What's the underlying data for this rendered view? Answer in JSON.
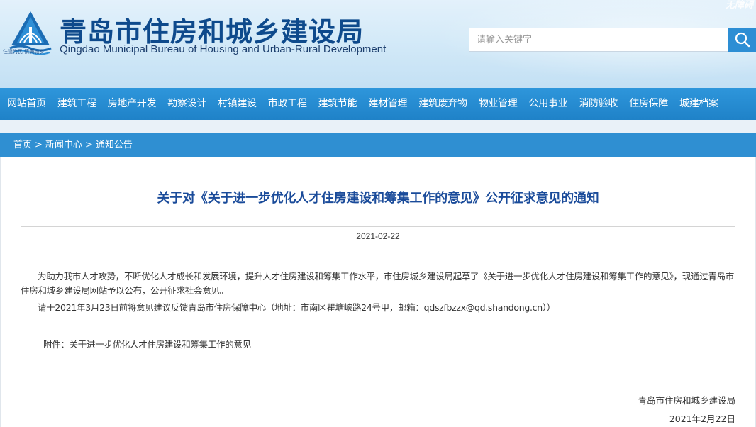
{
  "header": {
    "title_cn": "青岛市住房和城乡建设局",
    "title_en": "Qingdao Municipal Bureau of Housing and Urban-Rural Development",
    "slogan": "住建为民 情满城乡",
    "watermark": "无障碍",
    "search_placeholder": "请输入关键字"
  },
  "nav": {
    "items": [
      "网站首页",
      "建筑工程",
      "房地产开发",
      "勘察设计",
      "村镇建设",
      "市政工程",
      "建筑节能",
      "建材管理",
      "建筑废弃物",
      "物业管理",
      "公用事业",
      "消防验收",
      "住房保障",
      "城建档案"
    ]
  },
  "breadcrumb": {
    "items": [
      "首页",
      "新闻中心",
      "通知公告"
    ],
    "separator": ">"
  },
  "article": {
    "title": "关于对《关于进一步优化人才住房建设和筹集工作的意见》公开征求意见的通知",
    "date": "2021-02-22",
    "paragraph1": "为助力我市人才攻势，不断优化人才成长和发展环境，提升人才住房建设和筹集工作水平，市住房城乡建设局起草了《关于进一步优化人才住房建设和筹集工作的意见》，现通过青岛市住房和城乡建设局网站予以公布，公开征求社会意见。",
    "paragraph2": "请于2021年3月23日前将意见建议反馈青岛市住房保障中心（地址：市南区瞿塘峡路24号甲，邮箱：qdszfbzzx@qd.shandong.cn））",
    "attachment": "附件：关于进一步优化人才住房建设和筹集工作的意见",
    "signature_org": "青岛市住房和城乡建设局",
    "signature_date": "2021年2月22日"
  },
  "colors": {
    "brand_blue": "#1f82c8",
    "title_blue": "#1a4b9a",
    "header_bg": "#d4eaf8"
  }
}
